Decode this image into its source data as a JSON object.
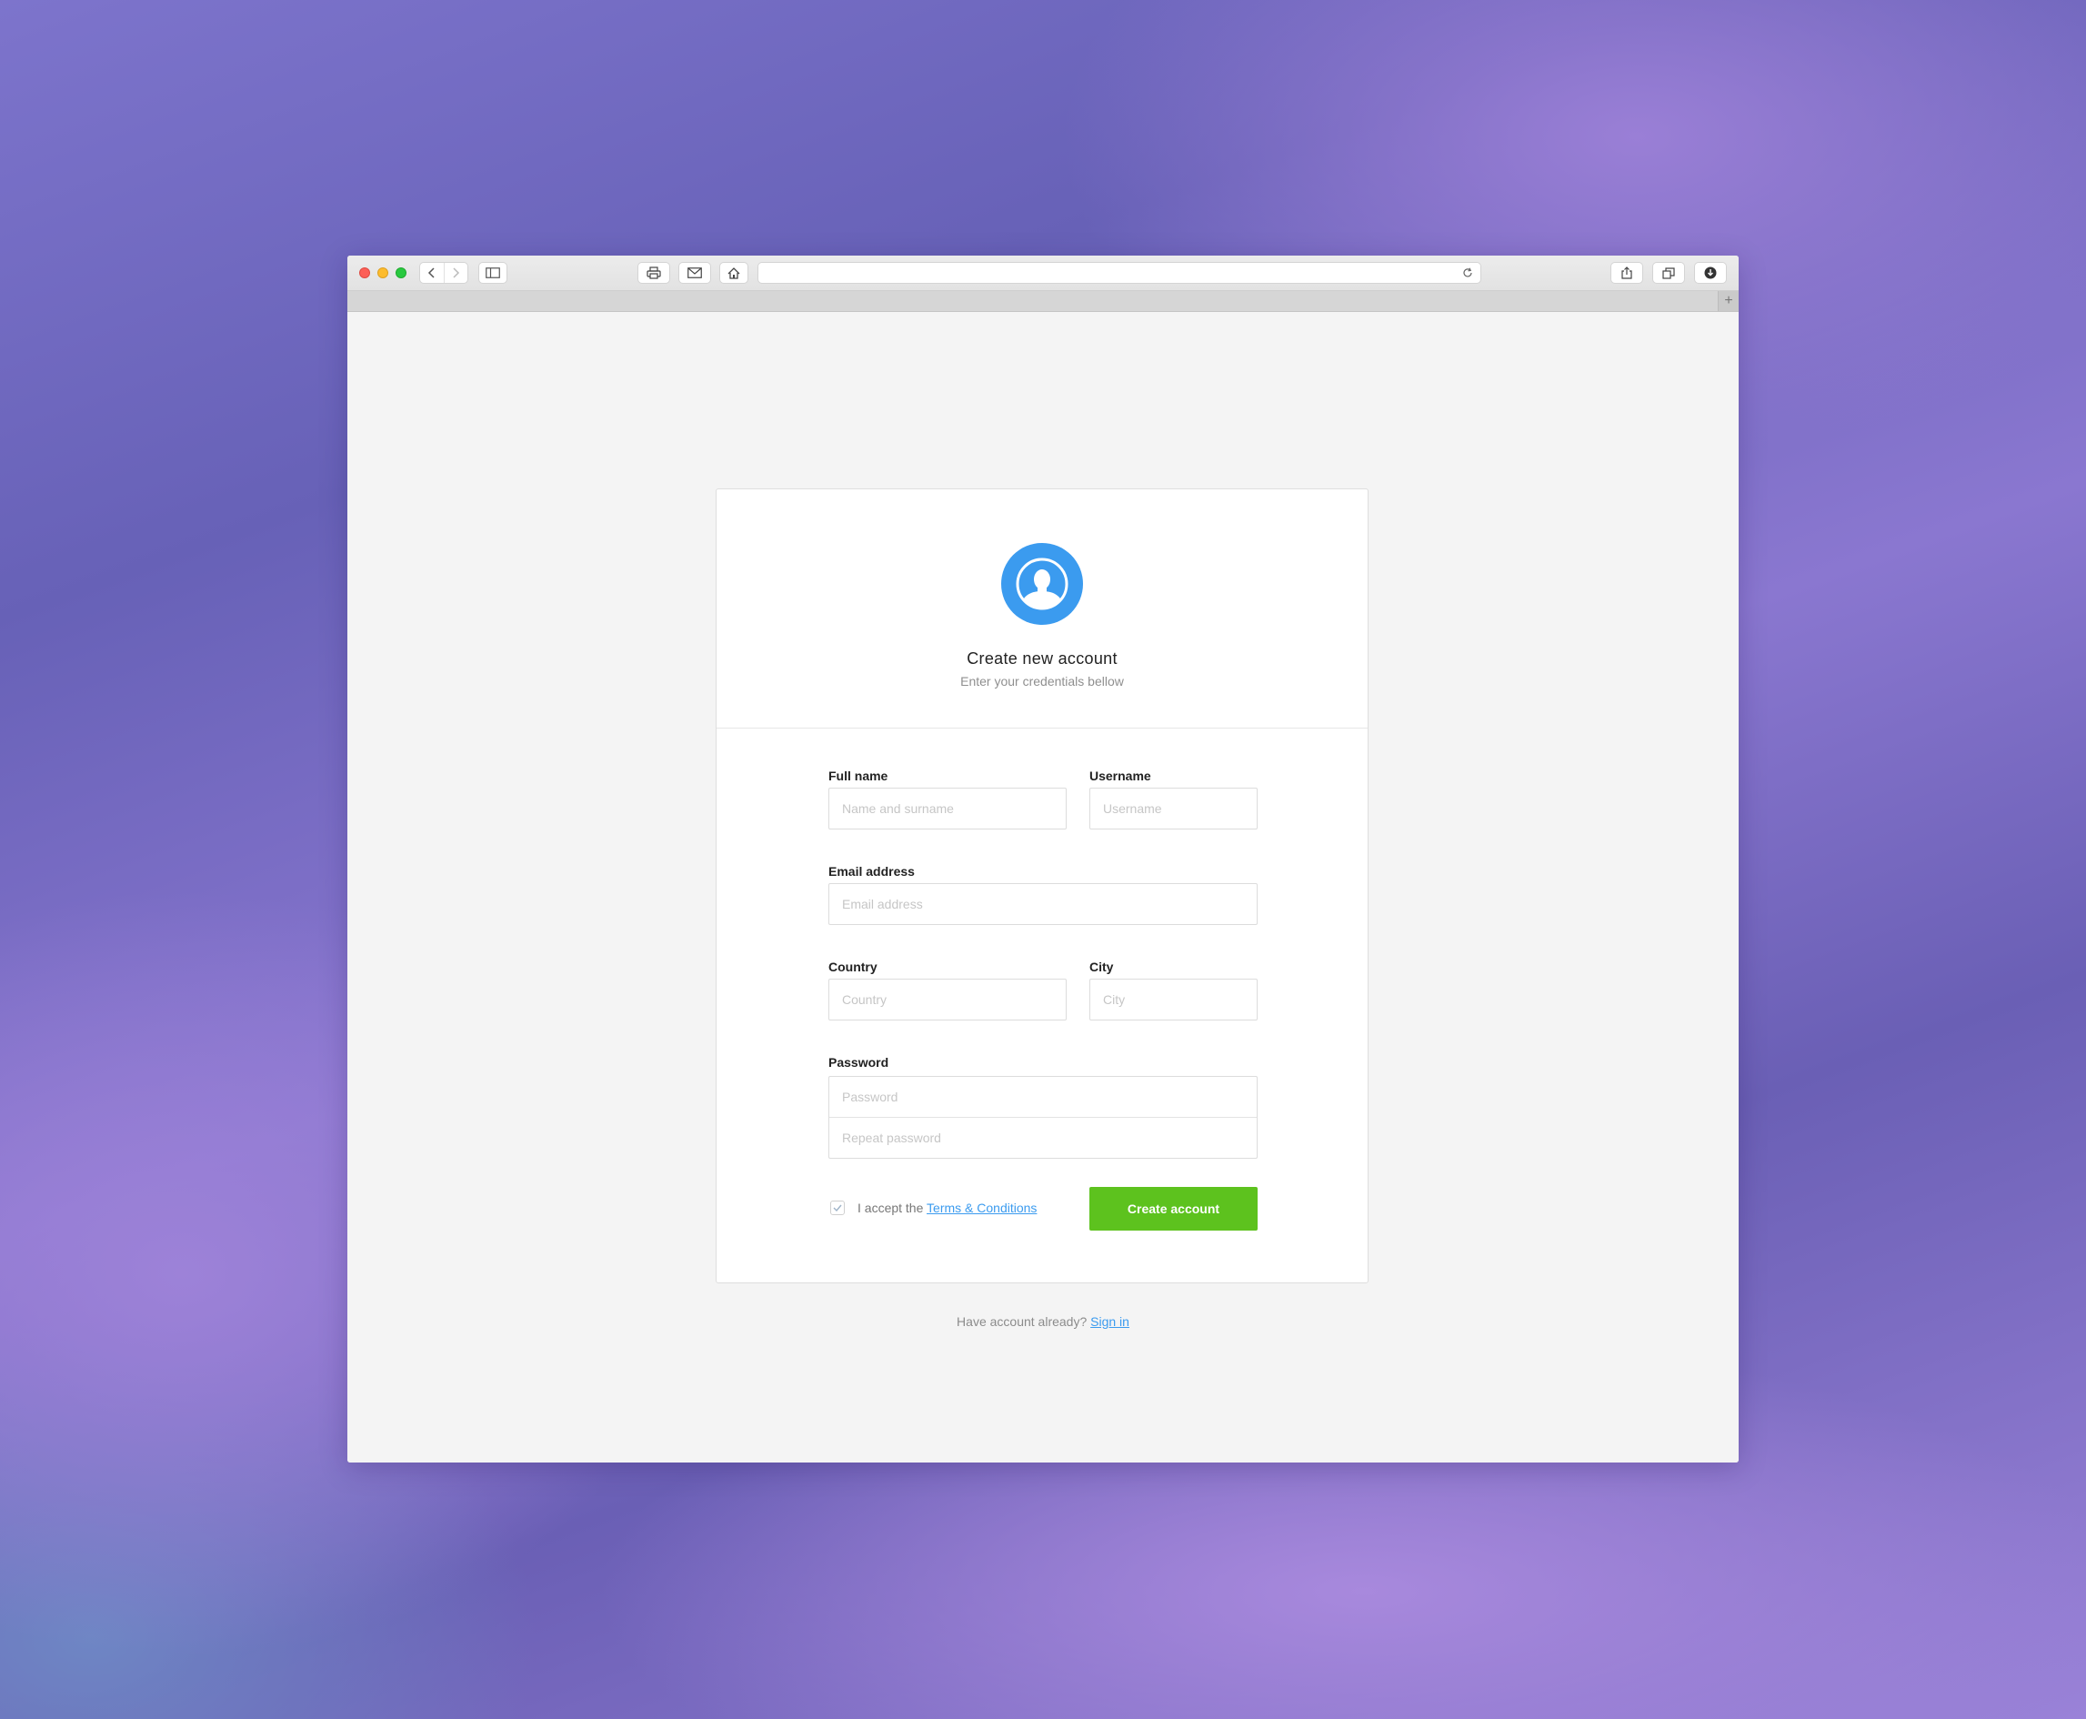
{
  "browser": {
    "back_icon": "chevron-left-icon",
    "forward_icon": "chevron-right-icon",
    "sidebar_icon": "sidebar-icon",
    "print_icon": "print-icon",
    "mail_icon": "mail-icon",
    "home_icon": "home-icon",
    "reload_icon": "reload-icon",
    "share_icon": "share-icon",
    "tabs_icon": "tabs-icon",
    "download_icon": "download-icon",
    "newtab_label": "+"
  },
  "form": {
    "title": "Create new account",
    "subtitle": "Enter your credentials bellow",
    "fullname_label": "Full name",
    "fullname_placeholder": "Name and surname",
    "username_label": "Username",
    "username_placeholder": "Username",
    "email_label": "Email address",
    "email_placeholder": "Email address",
    "country_label": "Country",
    "country_placeholder": "Country",
    "city_label": "City",
    "city_placeholder": "City",
    "password_label": "Password",
    "password_placeholder": "Password",
    "repeat_password_placeholder": "Repeat password",
    "accept_prefix": "I accept the",
    "terms_link": "Terms & Conditions",
    "submit_label": "Create account",
    "accent_color": "#3b9bef",
    "submit_color": "#5dc21e"
  },
  "footer": {
    "prompt": "Have account already?",
    "signin_link": "Sign in"
  }
}
